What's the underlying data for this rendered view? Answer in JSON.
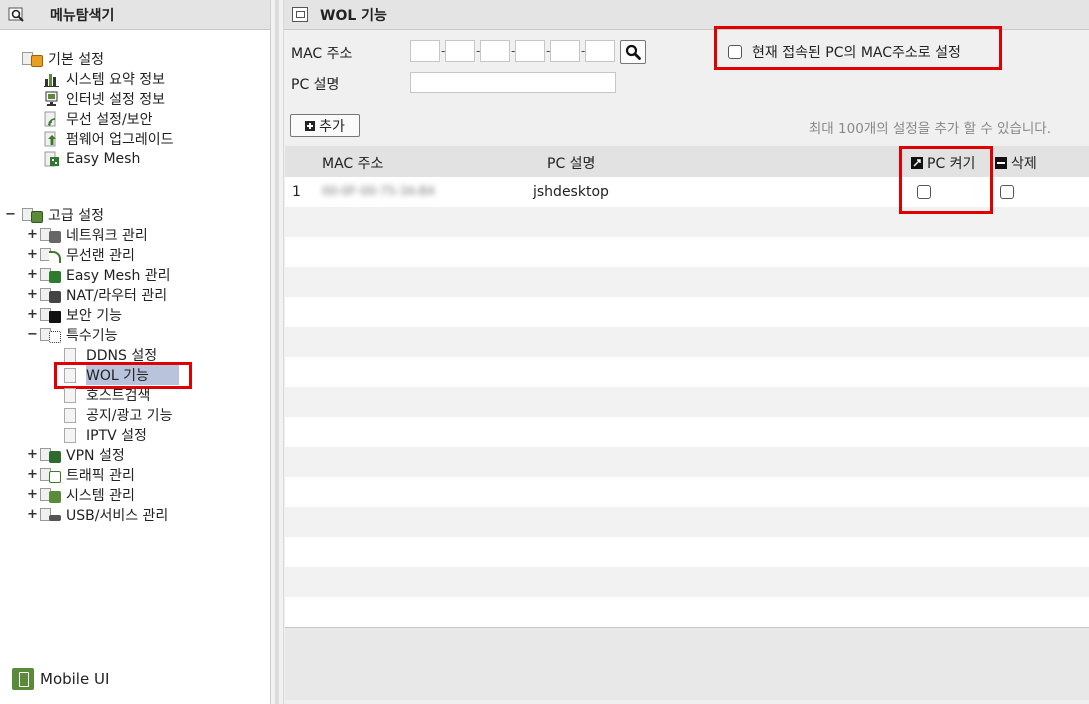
{
  "sidebar": {
    "title": "메뉴탐색기",
    "basic": {
      "label": "기본 설정",
      "items": [
        "시스템 요약 정보",
        "인터넷 설정 정보",
        "무선 설정/보안",
        "펌웨어 업그레이드",
        "Easy Mesh"
      ]
    },
    "advanced": {
      "label": "고급 설정",
      "items": [
        "네트워크 관리",
        "무선랜 관리",
        "Easy Mesh 관리",
        "NAT/라우터 관리",
        "보안 기능",
        "특수기능"
      ],
      "special": [
        "DDNS 설정",
        "WOL 기능",
        "호스트검색",
        "공지/광고 기능",
        "IPTV 설정"
      ],
      "more": [
        "VPN 설정",
        "트래픽 관리",
        "시스템 관리",
        "USB/서비스 관리"
      ]
    },
    "mobile_ui": "Mobile UI"
  },
  "main": {
    "title": "WOL 기능",
    "mac_label": "MAC 주소",
    "pcdesc_label": "PC 설명",
    "auto_mac_label": "현재 접속된 PC의 MAC주소로 설정",
    "add_label": "추가",
    "max_note": "최대 100개의 설정을 추가 할 수 있습니다.",
    "table": {
      "headers": {
        "mac": "MAC 주소",
        "desc": "PC 설명",
        "power": "PC 켜기",
        "delete": "삭제"
      },
      "rows": [
        {
          "index": "1",
          "mac": "00-0F-00-75-3A-B4",
          "desc": "jshdesktop"
        }
      ]
    }
  },
  "colors": {
    "highlight_red": "#e00000",
    "selection_bg": "#b9c3dc"
  }
}
